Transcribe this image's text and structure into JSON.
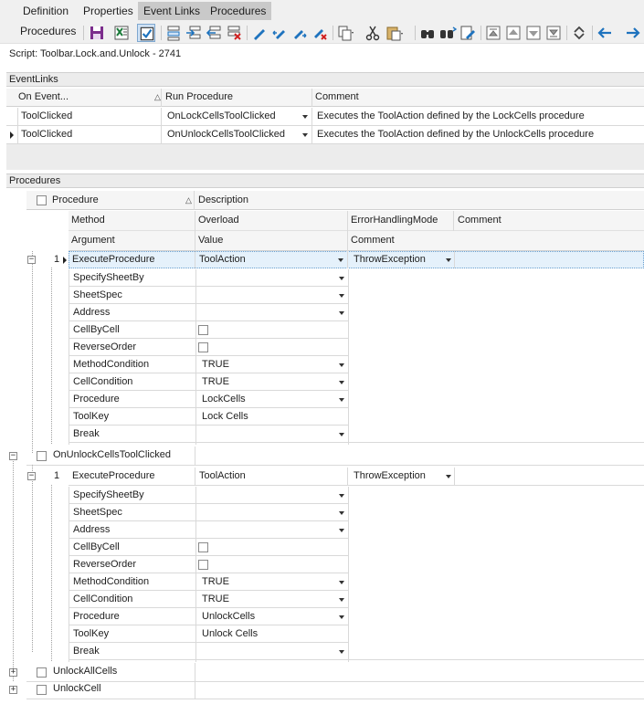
{
  "menu": {
    "tabs": [
      "Definition",
      "Properties",
      "Event Links",
      "Procedures"
    ]
  },
  "toolbar": {
    "label": "Procedures",
    "icons": [
      "save-icon",
      "export-excel-icon",
      "checkbox-toggle-icon",
      "add-row-icon",
      "insert-row-icon",
      "insert-before-icon",
      "delete-row-icon",
      "edit-pencil-icon",
      "edit-back-icon",
      "edit-forward-icon",
      "edit-clear-icon",
      "copy-icon",
      "cut-icon",
      "paste-icon",
      "find-icon",
      "find-next-icon",
      "find-replace-icon",
      "move-top-icon",
      "move-up-icon",
      "move-down-icon",
      "move-bottom-icon",
      "collapse-expand-icon",
      "back-arrow-icon",
      "forward-arrow-icon"
    ]
  },
  "script_title": "Script: Toolbar.Lock.and.Unlock - 2741",
  "eventlinks": {
    "title": "EventLinks",
    "columns": [
      "On Event...",
      "Run Procedure",
      "Comment"
    ],
    "rows": [
      [
        "ToolClicked",
        "OnLockCellsToolClicked",
        "Executes the ToolAction defined by the LockCells procedure"
      ],
      [
        "ToolClicked",
        "OnUnlockCellsToolClicked",
        "Executes the ToolAction defined by the UnlockCells procedure"
      ]
    ]
  },
  "procedures": {
    "title": "Procedures",
    "columns": [
      "Procedure",
      "Description"
    ],
    "method_columns": [
      "Method",
      "Overload",
      "ErrorHandlingMode",
      "Comment"
    ],
    "argument_columns": [
      "Argument",
      "Value",
      "Comment"
    ],
    "blocks": [
      {
        "method_index": "1",
        "method": "ExecuteProcedure",
        "overload": "ToolAction",
        "error_mode": "ThrowException",
        "args": [
          {
            "name": "SpecifySheetBy",
            "value": ""
          },
          {
            "name": "SheetSpec",
            "value": ""
          },
          {
            "name": "Address",
            "value": ""
          },
          {
            "name": "CellByCell",
            "value": ""
          },
          {
            "name": "ReverseOrder",
            "value": ""
          },
          {
            "name": "MethodCondition",
            "value": "TRUE"
          },
          {
            "name": "CellCondition",
            "value": "TRUE"
          },
          {
            "name": "Procedure",
            "value": "LockCells"
          },
          {
            "name": "ToolKey",
            "value": "Lock Cells"
          },
          {
            "name": "Break",
            "value": ""
          }
        ]
      },
      {
        "procedure": "OnUnlockCellsToolClicked",
        "method_index": "1",
        "method": "ExecuteProcedure",
        "overload": "ToolAction",
        "error_mode": "ThrowException",
        "args": [
          {
            "name": "SpecifySheetBy",
            "value": ""
          },
          {
            "name": "SheetSpec",
            "value": ""
          },
          {
            "name": "Address",
            "value": ""
          },
          {
            "name": "CellByCell",
            "value": ""
          },
          {
            "name": "ReverseOrder",
            "value": ""
          },
          {
            "name": "MethodCondition",
            "value": "TRUE"
          },
          {
            "name": "CellCondition",
            "value": "TRUE"
          },
          {
            "name": "Procedure",
            "value": "UnlockCells"
          },
          {
            "name": "ToolKey",
            "value": "Unlock Cells"
          },
          {
            "name": "Break",
            "value": ""
          }
        ]
      }
    ],
    "collapsed": [
      "UnlockAllCells",
      "UnlockCell"
    ]
  },
  "colors": {
    "section_bg": "#ececec",
    "selection": "#e5f1fb",
    "accent_blue": "#1e73be",
    "active_tab": "#c9c9c9"
  }
}
